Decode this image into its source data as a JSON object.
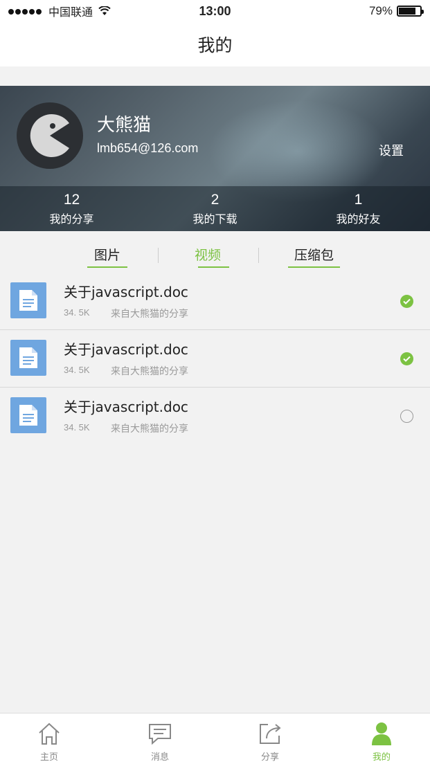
{
  "status_bar": {
    "carrier": "中国联通",
    "time": "13:00",
    "battery": "79%",
    "battery_level": 0.79
  },
  "header": {
    "title": "我的"
  },
  "profile": {
    "nickname": "大熊猫",
    "email": "lmb654@126.com",
    "settings_label": "设置",
    "stats": [
      {
        "value": "12",
        "label": "我的分享"
      },
      {
        "value": "2",
        "label": "我的下载"
      },
      {
        "value": "1",
        "label": "我的好友"
      }
    ]
  },
  "tabs": [
    {
      "label": "图片",
      "active": false
    },
    {
      "label": "视频",
      "active": true
    },
    {
      "label": "压缩包",
      "active": false
    }
  ],
  "files": [
    {
      "name": "关于javascript.doc",
      "size": "34. 5K",
      "source": "来自大熊猫的分享",
      "checked": true
    },
    {
      "name": "关于javascript.doc",
      "size": "34. 5K",
      "source": "来自大熊猫的分享",
      "checked": true
    },
    {
      "name": "关于javascript.doc",
      "size": "34. 5K",
      "source": "来自大熊猫的分享",
      "checked": false
    }
  ],
  "tab_bar": [
    {
      "label": "主页",
      "icon": "home-icon",
      "active": false
    },
    {
      "label": "消息",
      "icon": "message-icon",
      "active": false
    },
    {
      "label": "分享",
      "icon": "share-icon",
      "active": false
    },
    {
      "label": "我的",
      "icon": "user-icon",
      "active": true
    }
  ],
  "colors": {
    "accent": "#7cc242",
    "doc_icon": "#6fa6e0"
  }
}
